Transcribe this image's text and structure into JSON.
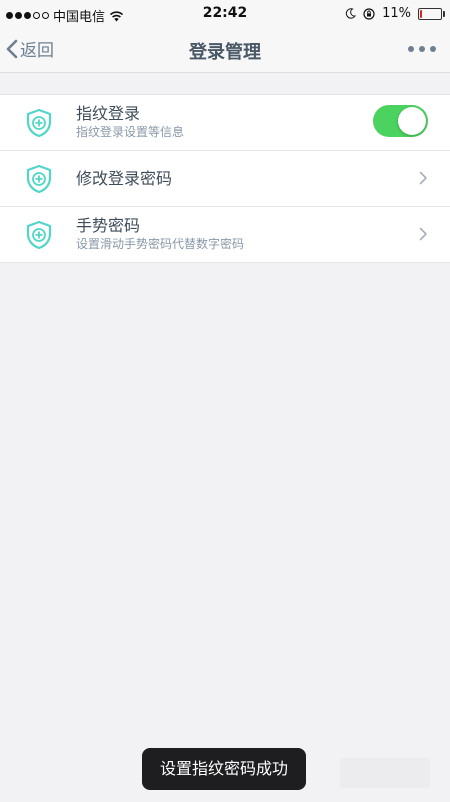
{
  "status_bar": {
    "carrier": "中国电信",
    "time": "22:42",
    "battery_percent": 11,
    "battery_label": "11%"
  },
  "nav": {
    "back_label": "返回",
    "title": "登录管理"
  },
  "items": [
    {
      "title": "指纹登录",
      "subtitle": "指纹登录设置等信息",
      "toggle_on": true
    },
    {
      "title": "修改登录密码"
    },
    {
      "title": "手势密码",
      "subtitle": "设置滑动手势密码代替数字密码"
    }
  ],
  "toast": {
    "text": "设置指纹密码成功"
  },
  "colors": {
    "icon_accent": "#52d6c8",
    "toggle_on": "#4cd35f",
    "nav_text": "#6d7f90"
  }
}
